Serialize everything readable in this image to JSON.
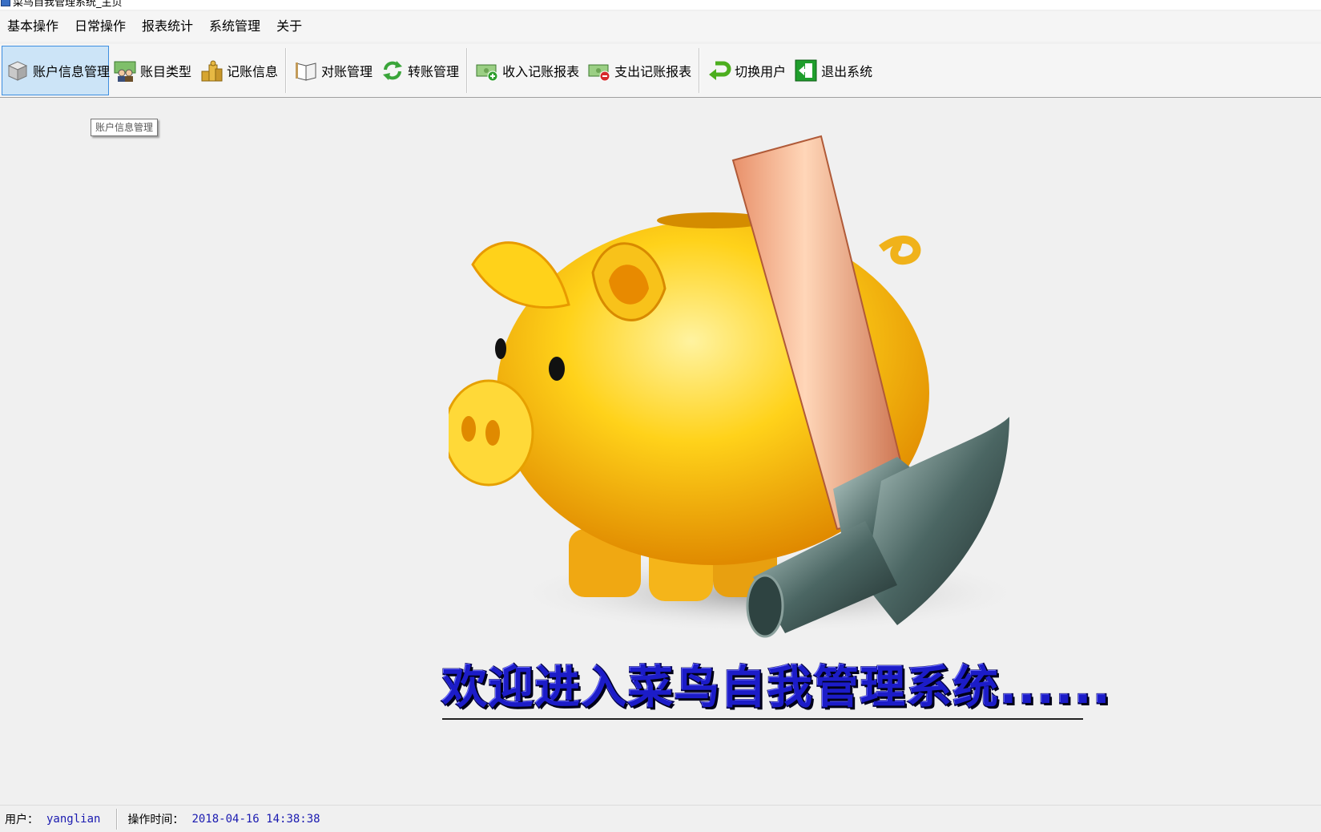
{
  "window": {
    "title": "菜鸟自我管理系统_主页"
  },
  "menu": {
    "items": [
      "基本操作",
      "日常操作",
      "报表统计",
      "系统管理",
      "关于"
    ]
  },
  "toolbar": {
    "account_info": "账户信息管理",
    "account_type": "账目类型",
    "bookkeeping_info": "记账信息",
    "reconcile": "对账管理",
    "transfer": "转账管理",
    "income_report": "收入记账报表",
    "expense_report": "支出记账报表",
    "switch_user": "切换用户",
    "exit_system": "退出系统"
  },
  "tooltip": {
    "text": "账户信息管理"
  },
  "welcome": {
    "text": "欢迎进入菜鸟自我管理系统......"
  },
  "status": {
    "user_label": "用户：",
    "user_value": "yanglian",
    "time_label": "操作时间：",
    "time_value": "2018-04-16 14:38:38"
  },
  "colors": {
    "active_button_bg": "#cce4f7",
    "active_button_border": "#3d8ee0",
    "status_value": "#1a1ab0",
    "welcome_text": "#1c1cc8"
  },
  "icons": {
    "account_info": "box-icon",
    "account_type": "people-money-icon",
    "bookkeeping_info": "money-bags-icon",
    "reconcile": "open-book-icon",
    "transfer": "green-cycle-arrows-icon",
    "income_report": "banknote-plus-icon",
    "expense_report": "banknote-minus-icon",
    "switch_user": "green-return-arrow-icon",
    "exit_system": "exit-door-icon"
  }
}
